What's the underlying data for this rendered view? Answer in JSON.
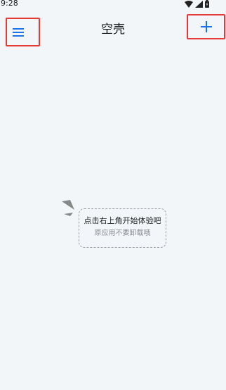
{
  "status_bar": {
    "time": "9:28",
    "icons": [
      "wifi-icon",
      "signal-icon",
      "battery-icon"
    ]
  },
  "header": {
    "title": "空壳",
    "menu_icon": "hamburger-menu-icon",
    "add_icon": "plus-icon"
  },
  "empty_state": {
    "primary_text": "点击右上角开始体验吧",
    "secondary_text": "原应用不要卸载哦"
  },
  "colors": {
    "background": "#f3f6f9",
    "accent": "#1a73e8",
    "highlight": "#e53935",
    "muted_text": "#8a8f95"
  }
}
